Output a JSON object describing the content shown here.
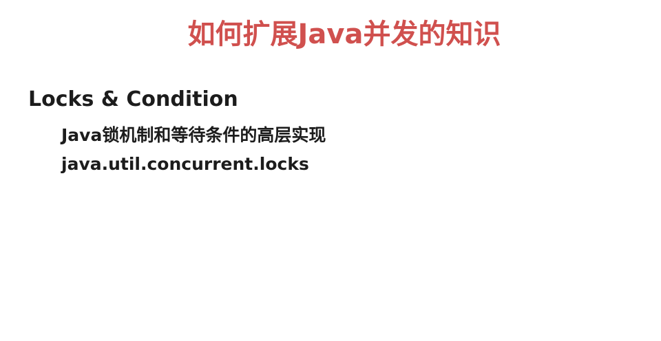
{
  "colors": {
    "title": "#d0504e",
    "text": "#1c1c1c",
    "background": "#ffffff"
  },
  "slide": {
    "title": "如何扩展Java并发的知识",
    "section": {
      "heading": "Locks & Condition",
      "items": [
        "Java锁机制和等待条件的高层实现",
        "java.util.concurrent.locks"
      ]
    }
  }
}
